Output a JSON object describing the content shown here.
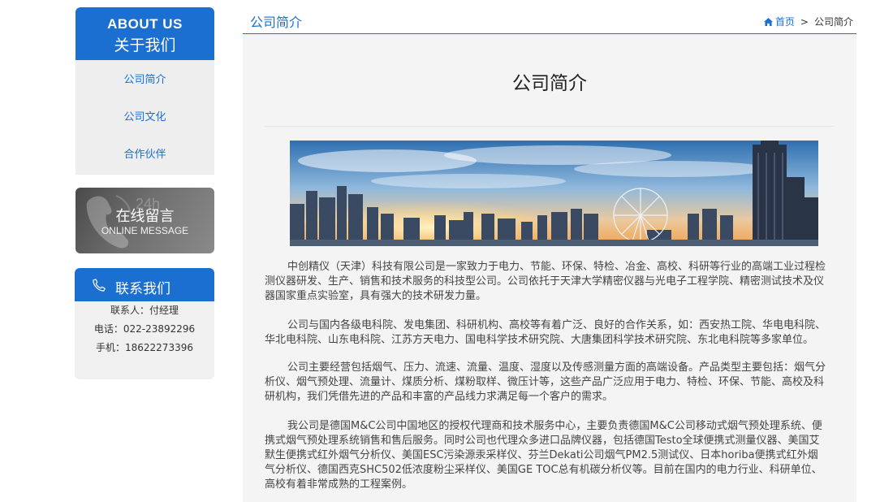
{
  "sidebar": {
    "about": {
      "title_en": "ABOUT US",
      "title_cn": "关于我们",
      "items": [
        {
          "label": "公司简介"
        },
        {
          "label": "公司文化"
        },
        {
          "label": "合作伙伴"
        }
      ]
    },
    "message": {
      "badge": "24h",
      "title_cn": "在线留言",
      "title_en": "ONLINE MESSAGE"
    },
    "contact": {
      "title": "联系我们",
      "contact_person": "联系人：付经理",
      "tel": "电话：022-23892296",
      "mobile": "手机：18622273396"
    }
  },
  "header": {
    "title": "公司简介",
    "breadcrumb": {
      "home": "首页",
      "separator": ">",
      "current": "公司简介"
    }
  },
  "content": {
    "title": "公司简介",
    "paragraphs": [
      "中创精仪（天津）科技有限公司是一家致力于电力、节能、环保、特检、冶金、高校、科研等行业的高端工业过程检测仪器研发、生产、销售和技术服务的科技型公司。公司依托于天津大学精密仪器与光电子工程学院、精密测试技术及仪器国家重点实验室，具有强大的技术研发力量。",
      "公司与国内各级电科院、发电集团、科研机构、高校等有着广泛、良好的合作关系，如：西安热工院、华电电科院、华北电科院、山东电科院、江苏方天电力、国电科学技术研究院、大唐集团科学技术研究院、东北电科院等多家单位。",
      "公司主要经营包括烟气、压力、流速、流量、温度、湿度以及传感测量方面的高端设备。产品类型主要包括：烟气分析仪、烟气预处理、流量计、煤质分析、煤粉取样、微压计等，这些产品广泛应用于电力、特检、环保、节能、高校及科研机构，我们凭借先进的产品和丰富的产品线力求满足每一个客户的需求。",
      "我公司是德国M&C公司中国地区的授权代理商和技术服务中心，主要负责德国M&C公司移动式烟气预处理系统、便携式烟气预处理系统销售和售后服务。同时公司也代理众多进口品牌仪器，包括德国Testo全球便携式测量仪器、美国艾默生便携式红外烟气分析仪、美国ESC污染源汞采样仪、芬兰Dekati公司烟气PM2.5测试仪、日本horiba便携式红外烟气分析仪、德国西克SHC502低浓度粉尘采样仪、美国GE TOC总有机碳分析仪等。目前在国内的电力行业、科研单位、高校有着非常成熟的工程案例。"
    ]
  },
  "colors": {
    "accent": "#1a6fd1",
    "sidebar_bg": "#eeeeee",
    "content_bg": "#f4f4f4"
  },
  "icons": {
    "home": "home-icon",
    "phone": "phone-icon",
    "message": "telephone-handset-icon"
  }
}
